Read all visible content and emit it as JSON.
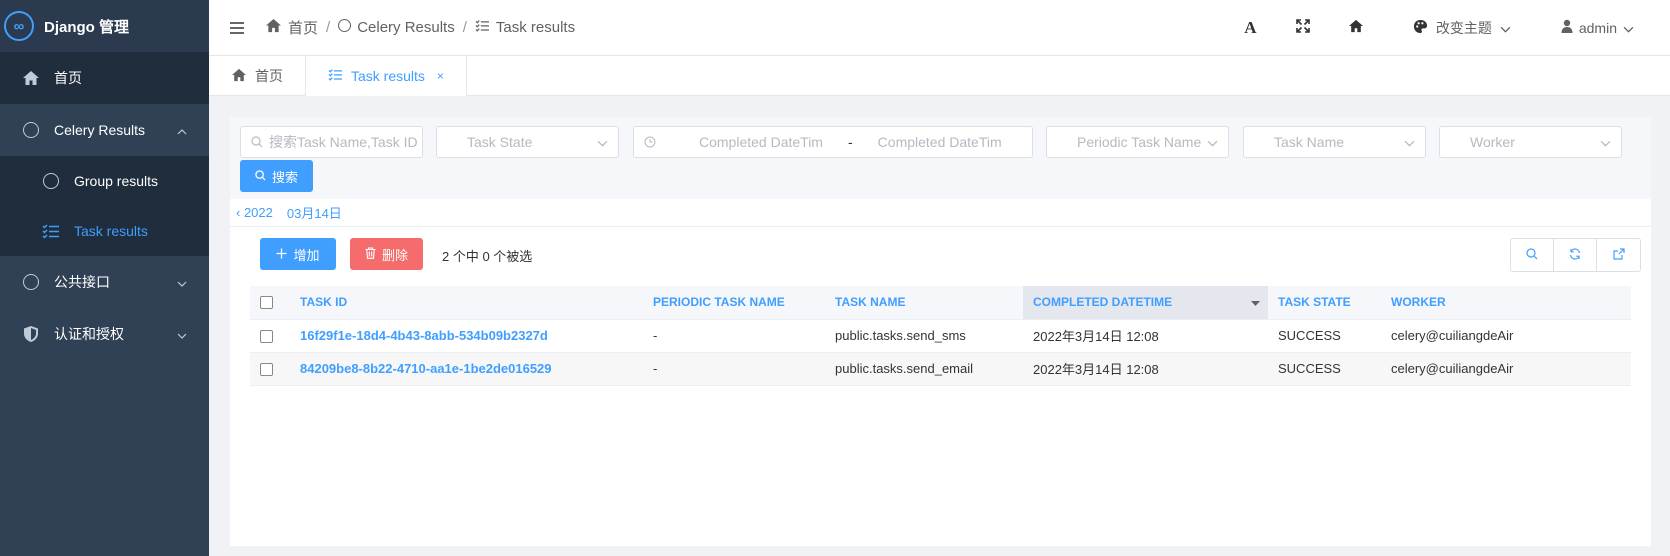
{
  "sidebar": {
    "logo_text": "Django 管理",
    "logo_mark": "∞",
    "items": [
      {
        "label": "首页",
        "icon": "home-icon"
      },
      {
        "label": "Celery Results",
        "icon": "circle-icon"
      },
      {
        "label": "Group results",
        "icon": "circle-icon"
      },
      {
        "label": "Task results",
        "icon": "task-list-icon"
      },
      {
        "label": "公共接口",
        "icon": "circle-icon"
      },
      {
        "label": "认证和授权",
        "icon": "shield-icon"
      }
    ]
  },
  "header": {
    "breadcrumb": [
      "首页",
      "Celery Results",
      "Task results"
    ],
    "sep": "/",
    "font_icon_glyph": "A",
    "theme_label": "改变主题",
    "user_label": "admin"
  },
  "tabs": [
    {
      "label": "首页"
    },
    {
      "label": "Task results",
      "close": "×"
    }
  ],
  "filters": {
    "search_placeholder": "搜索Task Name,Task ID",
    "task_state": "Task State",
    "completed_start": "Completed DateTim",
    "range_sep": "-",
    "completed_end": "Completed DateTim",
    "periodic_task": "Periodic Task Name",
    "task_name": "Task Name",
    "worker": "Worker",
    "search_button": "搜索"
  },
  "datenav": {
    "year": "‹ 2022",
    "day": "03月14日"
  },
  "actions": {
    "add": "增加",
    "delete": "删除",
    "selected_text": "2 个中 0 个被选"
  },
  "table": {
    "columns": [
      "TASK ID",
      "PERIODIC TASK NAME",
      "TASK NAME",
      "COMPLETED DATETIME",
      "TASK STATE",
      "WORKER"
    ],
    "rows": [
      [
        "16f29f1e-18d4-4b43-8abb-534b09b2327d",
        "-",
        "public.tasks.send_sms",
        "2022年3月14日 12:08",
        "SUCCESS",
        "celery@cuiliangdeAir"
      ],
      [
        "84209be8-8b22-4710-aa1e-1be2de016529",
        "-",
        "public.tasks.send_email",
        "2022年3月14日 12:08",
        "SUCCESS",
        "celery@cuiliangdeAir"
      ]
    ]
  },
  "colors": {
    "accent": "#409eff",
    "danger": "#f56c6c",
    "sidebar": "#304156"
  }
}
